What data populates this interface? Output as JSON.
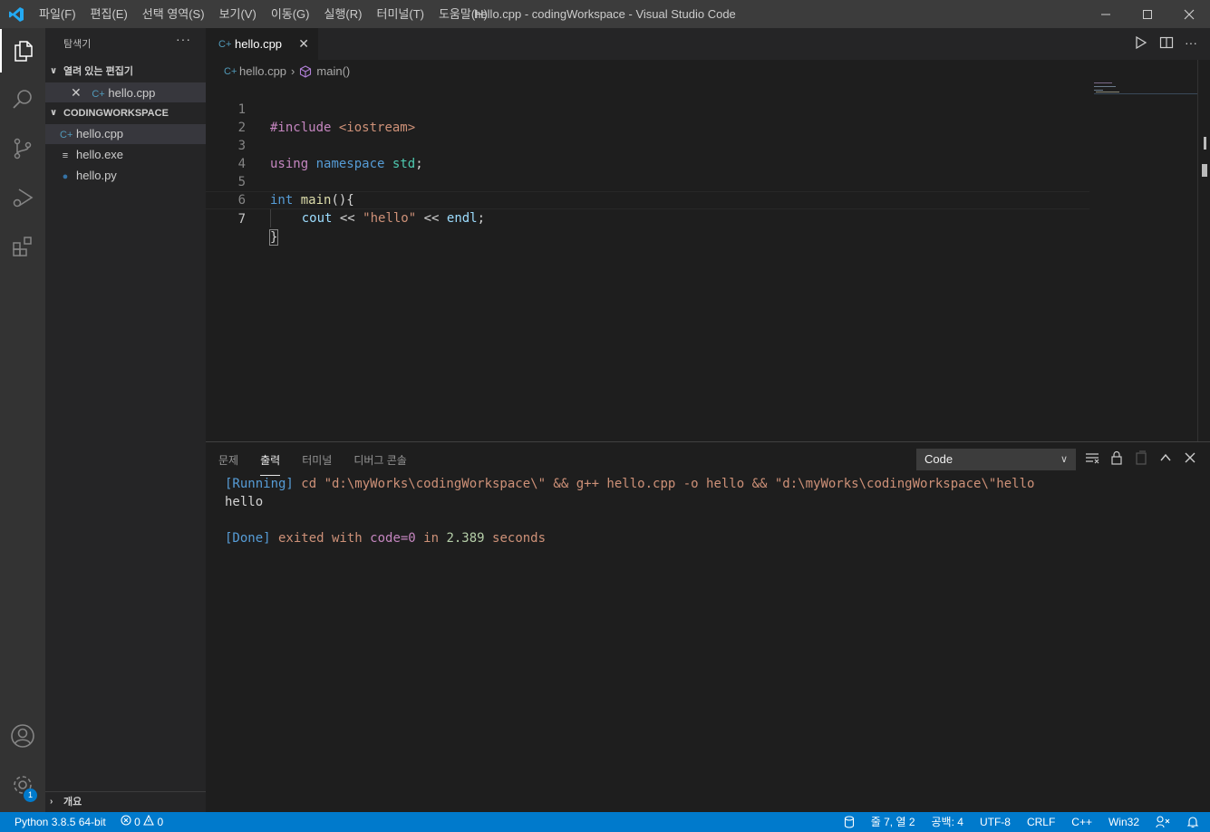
{
  "titlebar": {
    "menu": [
      "파일(F)",
      "편집(E)",
      "선택 영역(S)",
      "보기(V)",
      "이동(G)",
      "실행(R)",
      "터미널(T)",
      "도움말(H)"
    ],
    "title": "hello.cpp - codingWorkspace - Visual Studio Code"
  },
  "sidebar": {
    "title": "탐색기",
    "more": "···",
    "open_editors_label": "열려 있는 편집기",
    "open_editors": [
      {
        "name": "hello.cpp",
        "icon": "cpp-file-icon"
      }
    ],
    "workspace_label": "CODINGWORKSPACE",
    "files": [
      {
        "name": "hello.cpp",
        "icon": "cpp-file-icon"
      },
      {
        "name": "hello.exe",
        "icon": "text-file-icon"
      },
      {
        "name": "hello.py",
        "icon": "python-file-icon"
      }
    ],
    "outline_label": "개요"
  },
  "activity": {
    "settings_badge": "1"
  },
  "editor": {
    "tab_label": "hello.cpp",
    "breadcrumb": {
      "file": "hello.cpp",
      "symbol": "main()"
    },
    "line_numbers": [
      "1",
      "2",
      "3",
      "4",
      "5",
      "6",
      "7"
    ],
    "code": {
      "l1_directive": "#include",
      "l1_header": "<iostream>",
      "l3_using": "using",
      "l3_namespace": "namespace",
      "l3_std": "std",
      "l3_semi": ";",
      "l5_int": "int",
      "l5_main": "main",
      "l5_rest": "(){",
      "l6_indent": "    ",
      "l6_cout": "cout",
      "l6_op1": " << ",
      "l6_str": "\"hello\"",
      "l6_op2": " << ",
      "l6_endl": "endl",
      "l6_semi": ";",
      "l7_brace": "}"
    }
  },
  "panel": {
    "tabs": [
      "문제",
      "출력",
      "터미널",
      "디버그 콘솔"
    ],
    "active_tab": "출력",
    "output_channel": "Code",
    "output": {
      "running_tag": "[Running]",
      "running_cmd": " cd \"d:\\myWorks\\codingWorkspace\\\" && g++ hello.cpp -o hello && \"d:\\myWorks\\codingWorkspace\\\"hello",
      "result": "hello",
      "done_tag": "[Done]",
      "done_a": " exited with ",
      "done_code": "code=0",
      "done_b": " in ",
      "done_secs": "2.389",
      "done_c": " seconds"
    }
  },
  "statusbar": {
    "python": "Python 3.8.5 64-bit",
    "errors": "0",
    "warnings": "0",
    "position": "줄 7, 열 2",
    "spaces": "공백: 4",
    "encoding": "UTF-8",
    "eol": "CRLF",
    "language": "C++",
    "platform": "Win32"
  },
  "colors": {
    "accent": "#007acc",
    "titlebar": "#3c3c3c",
    "activitybar": "#333333",
    "sidebar": "#252526",
    "editor": "#1e1e1e"
  }
}
